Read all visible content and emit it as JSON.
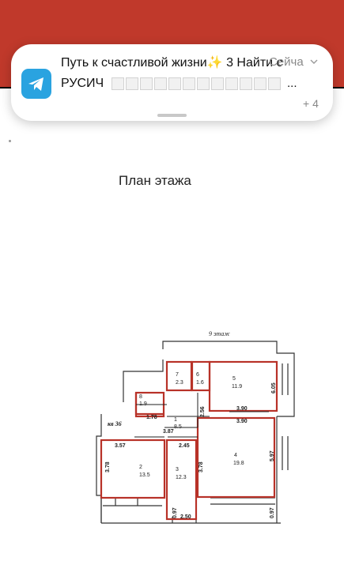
{
  "notification": {
    "app_icon": "telegram-icon",
    "title": "Путь к счастливой жизни✨ 3 Найти с",
    "time": "Сейчас",
    "sender": "РУСИЧ",
    "hidden_block_count": 12,
    "ellipsis": "...",
    "more_count": "+ 4"
  },
  "page": {
    "plan_title": "План этажа"
  },
  "floor_plan": {
    "floor_label": "9 этаж",
    "apartment_label": "кв 36",
    "rooms": [
      {
        "number": "1",
        "area": "8.5"
      },
      {
        "number": "2",
        "area": "13.5"
      },
      {
        "number": "3",
        "area": "12.3"
      },
      {
        "number": "4",
        "area": "19.8"
      },
      {
        "number": "5",
        "area": "11.9"
      },
      {
        "number": "6",
        "area": "1.6"
      },
      {
        "number": "7",
        "area": "2.3"
      },
      {
        "number": "8",
        "area": "1.9"
      }
    ],
    "dimensions": {
      "d_3_90_top": "3.90",
      "d_3_90_bottom": "3.90",
      "d_6_05": "6.05",
      "d_2_56": "2.56",
      "d_1_78": "1.78",
      "d_3_87": "3.87",
      "d_2_45": "2.45",
      "d_3_57": "3.57",
      "d_3_78_left": "3.78",
      "d_3_78_mid": "3.78",
      "d_5_97": "5.97",
      "d_0_97_left": "0.97",
      "d_2_50": "2.50",
      "d_0_97_right": "0.97"
    }
  },
  "colors": {
    "topbar": "#c0392b",
    "telegram": "#2aa3e0",
    "wall_highlight": "#b83228"
  }
}
